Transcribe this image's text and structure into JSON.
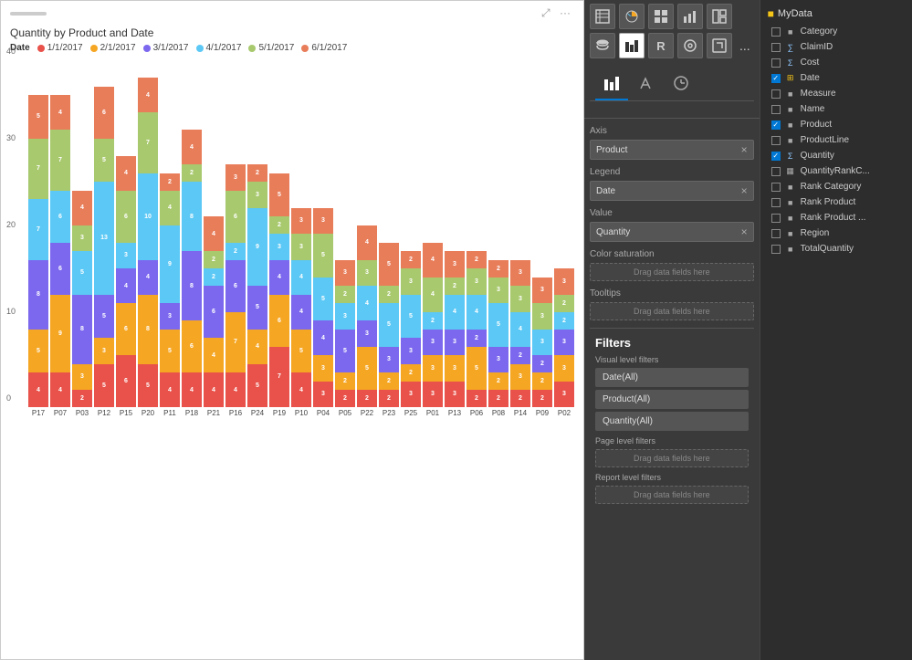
{
  "chart": {
    "title": "Quantity by Product and Date",
    "legend_label": "Date",
    "y_axis_max": 40,
    "y_ticks": [
      0,
      10,
      20,
      30,
      40
    ],
    "legend": [
      {
        "label": "1/1/2017",
        "color": "#e8524a"
      },
      {
        "label": "2/1/2017",
        "color": "#f5a623"
      },
      {
        "label": "3/1/2017",
        "color": "#7b68ee"
      },
      {
        "label": "4/1/2017",
        "color": "#5bc8f5"
      },
      {
        "label": "5/1/2017",
        "color": "#a8c96e"
      },
      {
        "label": "6/1/2017",
        "color": "#e87d5a"
      }
    ],
    "bars": [
      {
        "label": "P17",
        "segments": [
          4,
          5,
          8,
          7,
          7,
          5
        ],
        "total": 36
      },
      {
        "label": "P07",
        "segments": [
          4,
          9,
          6,
          6,
          7,
          4
        ],
        "total": 36
      },
      {
        "label": "P03",
        "segments": [
          2,
          3,
          8,
          5,
          3,
          4
        ],
        "total": 25
      },
      {
        "label": "P12",
        "segments": [
          5,
          3,
          5,
          13,
          5,
          6
        ],
        "total": 37
      },
      {
        "label": "P15",
        "segments": [
          6,
          6,
          4,
          3,
          6,
          4
        ],
        "total": 29
      },
      {
        "label": "P20",
        "segments": [
          5,
          8,
          4,
          10,
          7,
          4
        ],
        "total": 38
      },
      {
        "label": "P11",
        "segments": [
          4,
          5,
          3,
          9,
          4,
          2
        ],
        "total": 27
      },
      {
        "label": "P18",
        "segments": [
          4,
          6,
          8,
          8,
          2,
          4
        ],
        "total": 32
      },
      {
        "label": "P21",
        "segments": [
          4,
          4,
          6,
          2,
          2,
          4
        ],
        "total": 22
      },
      {
        "label": "P16",
        "segments": [
          4,
          7,
          6,
          2,
          6,
          3
        ],
        "total": 28
      },
      {
        "label": "P24",
        "segments": [
          5,
          4,
          5,
          9,
          3,
          2
        ],
        "total": 28
      },
      {
        "label": "P19",
        "segments": [
          7,
          6,
          4,
          3,
          2,
          5
        ],
        "total": 27
      },
      {
        "label": "P10",
        "segments": [
          4,
          5,
          4,
          4,
          3,
          3
        ],
        "total": 23
      },
      {
        "label": "P04",
        "segments": [
          3,
          3,
          4,
          5,
          5,
          3
        ],
        "total": 23
      },
      {
        "label": "P05",
        "segments": [
          2,
          2,
          5,
          3,
          2,
          3
        ],
        "total": 17
      },
      {
        "label": "P22",
        "segments": [
          2,
          5,
          3,
          4,
          3,
          4
        ],
        "total": 21
      },
      {
        "label": "P23",
        "segments": [
          2,
          2,
          3,
          5,
          2,
          5
        ],
        "total": 19
      },
      {
        "label": "P25",
        "segments": [
          3,
          2,
          3,
          5,
          3,
          2
        ],
        "total": 18
      },
      {
        "label": "P01",
        "segments": [
          3,
          3,
          3,
          2,
          4,
          4
        ],
        "total": 19
      },
      {
        "label": "P13",
        "segments": [
          3,
          3,
          3,
          4,
          2,
          3
        ],
        "total": 18
      },
      {
        "label": "P06",
        "segments": [
          2,
          5,
          2,
          4,
          3,
          2
        ],
        "total": 18
      },
      {
        "label": "P08",
        "segments": [
          2,
          2,
          3,
          5,
          3,
          2
        ],
        "total": 17
      },
      {
        "label": "P14",
        "segments": [
          2,
          3,
          2,
          4,
          3,
          3
        ],
        "total": 17
      },
      {
        "label": "P09",
        "segments": [
          2,
          2,
          2,
          3,
          3,
          3
        ],
        "total": 15
      },
      {
        "label": "P02",
        "segments": [
          3,
          3,
          3,
          2,
          2,
          3
        ],
        "total": 16
      }
    ],
    "drag_placeholder": "Drag data fields here"
  },
  "visualization_panel": {
    "tabs": [
      {
        "id": "chart-tab",
        "icon": "▦",
        "active": false
      },
      {
        "id": "format-tab",
        "icon": "🖌",
        "active": false
      },
      {
        "id": "analytics-tab",
        "icon": "📊",
        "active": false
      }
    ],
    "fields": {
      "axis_label": "Axis",
      "axis_value": "Product",
      "legend_label": "Legend",
      "legend_value": "Date",
      "value_label": "Value",
      "value_value": "Quantity",
      "color_saturation_label": "Color saturation",
      "tooltips_label": "Tooltips"
    }
  },
  "filters": {
    "title": "Filters",
    "visual_level_label": "Visual level filters",
    "visual_filters": [
      {
        "label": "Date(All)"
      },
      {
        "label": "Product(All)"
      },
      {
        "label": "Quantity(All)"
      }
    ],
    "page_level_label": "Page level filters",
    "page_placeholder": "Drag data fields here",
    "report_level_label": "Report level filters",
    "report_placeholder": "Drag data fields here"
  },
  "data_panel": {
    "title": "MyData",
    "fields": [
      {
        "name": "Category",
        "type": "text",
        "checked": false
      },
      {
        "name": "ClaimID",
        "type": "sigma-small",
        "checked": false
      },
      {
        "name": "Cost",
        "type": "sigma",
        "checked": false
      },
      {
        "name": "Date",
        "type": "calendar",
        "checked": true
      },
      {
        "name": "Measure",
        "type": "text",
        "checked": false
      },
      {
        "name": "Name",
        "type": "text",
        "checked": false
      },
      {
        "name": "Product",
        "type": "text",
        "checked": true
      },
      {
        "name": "ProductLine",
        "type": "text",
        "checked": false
      },
      {
        "name": "Quantity",
        "type": "sigma",
        "checked": true
      },
      {
        "name": "QuantityRankC...",
        "type": "bar-chart",
        "checked": false
      },
      {
        "name": "Rank Category",
        "type": "text",
        "checked": false
      },
      {
        "name": "Rank Product",
        "type": "text",
        "checked": false
      },
      {
        "name": "Rank Product ...",
        "type": "text",
        "checked": false
      },
      {
        "name": "Region",
        "type": "text",
        "checked": false
      },
      {
        "name": "TotalQuantity",
        "type": "text",
        "checked": false
      }
    ]
  },
  "toolbar": {
    "more_label": "...",
    "icons": [
      "table-icon",
      "filter-icon",
      "globe-icon",
      "chart-icon",
      "grid-icon",
      "copy-icon",
      "R-icon",
      "db-icon",
      "expand-icon"
    ]
  }
}
